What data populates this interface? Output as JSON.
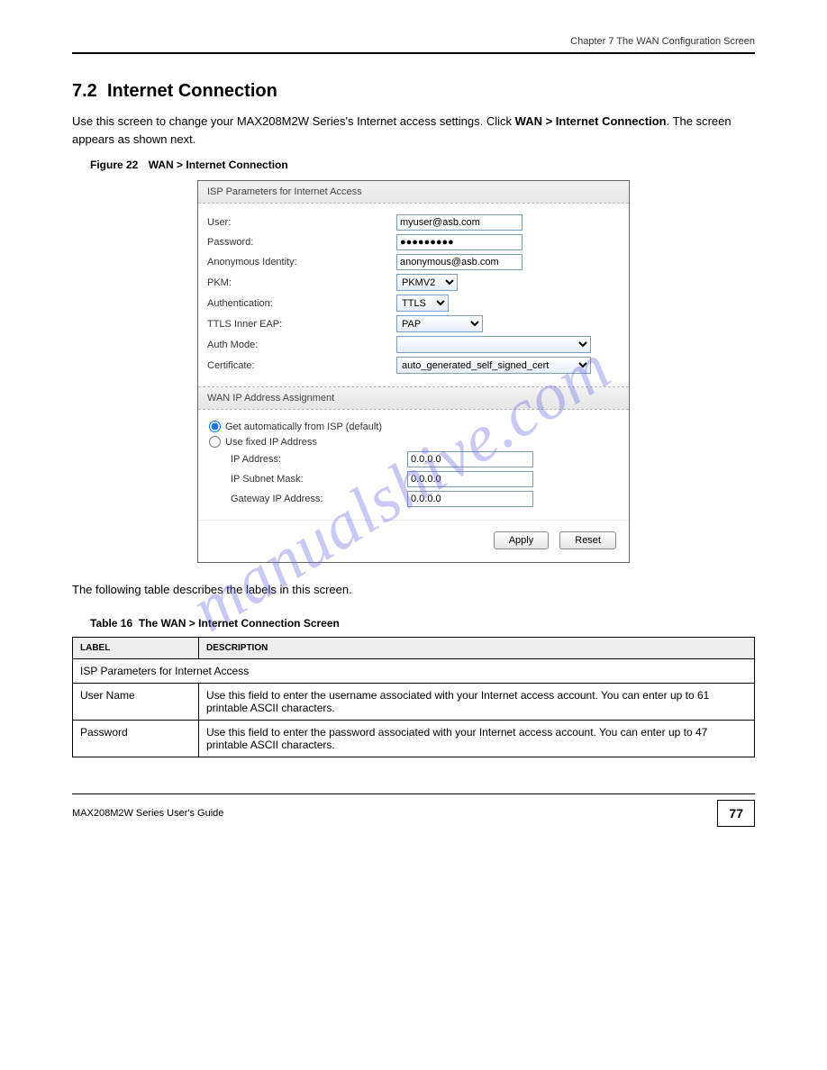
{
  "header": {
    "chapter": "Chapter 7 The WAN Configuration Screen"
  },
  "section": {
    "number": "7.2",
    "title": "Internet Connection",
    "intro_a": "Use this screen to change your MAX208M2W Series's Internet access settings. Click ",
    "intro_b": "Internet Connection",
    "intro_c": ". The screen appears as shown next.",
    "intro_prefix": "WAN > "
  },
  "figure": {
    "num": "Figure 22",
    "caption": "WAN > Internet Connection"
  },
  "panel": {
    "section1_title": "ISP Parameters for Internet Access",
    "user_label": "User:",
    "user_value": "myuser@asb.com",
    "password_label": "Password:",
    "password_value": "●●●●●●●●●",
    "anon_label": "Anonymous Identity:",
    "anon_value": "anonymous@asb.com",
    "pkm_label": "PKM:",
    "pkm_value": "PKMV2",
    "auth_label": "Authentication:",
    "auth_value": "TTLS",
    "inner_label": "TTLS Inner EAP:",
    "inner_value": "PAP",
    "authmode_label": "Auth Mode:",
    "authmode_value": "",
    "cert_label": "Certificate:",
    "cert_value": "auto_generated_self_signed_cert",
    "section2_title": "WAN IP Address Assignment",
    "radio1": "Get automatically from ISP (default)",
    "radio2": "Use fixed IP Address",
    "ip_label": "IP Address:",
    "ip_value": "0.0.0.0",
    "mask_label": "IP Subnet Mask:",
    "mask_value": "0.0.0.0",
    "gw_label": "Gateway IP Address:",
    "gw_value": "0.0.0.0",
    "apply": "Apply",
    "reset": "Reset"
  },
  "table_intro": "The following table describes the labels in this screen.",
  "table_caption_num": "Table 16",
  "table_caption": "The WAN > Internet Connection Screen",
  "table": {
    "col1": "LABEL",
    "col2": "DESCRIPTION",
    "section_row": "ISP Parameters for Internet Access",
    "r1_label": "User Name",
    "r1_desc": "Use this field to enter the username associated with your Internet access account. You can enter up to 61 printable ASCII characters.",
    "r2_label": "Password",
    "r2_desc": "Use this field to enter the password associated with your Internet access account. You can enter up to 47 printable ASCII characters."
  },
  "footer": {
    "guide": "MAX208M2W Series User's Guide",
    "page": "77"
  },
  "watermark": "manualshive.com"
}
